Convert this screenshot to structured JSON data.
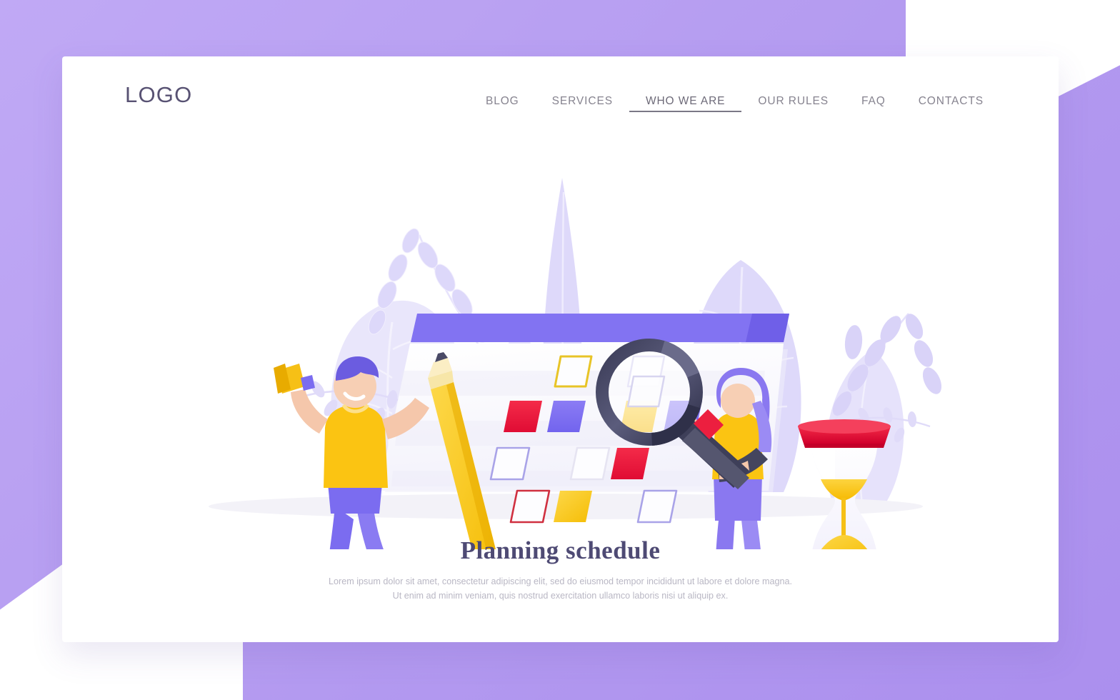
{
  "brand": {
    "logo_text": "LOGO",
    "logo_color": "#585273"
  },
  "nav": {
    "items": [
      {
        "label": "BLOG",
        "active": false
      },
      {
        "label": "SERVICES",
        "active": false
      },
      {
        "label": "WHO WE ARE",
        "active": true
      },
      {
        "label": "OUR RULES",
        "active": false
      },
      {
        "label": "FAQ",
        "active": false
      },
      {
        "label": "CONTACTS",
        "active": false
      }
    ]
  },
  "hero": {
    "title": "Planning schedule",
    "subtitle_line1": "Lorem ipsum dolor sit amet, consectetur adipiscing elit, sed do eiusmod tempor incididunt ut labore et dolore magna.",
    "subtitle_line2": "Ut enim ad minim veniam, quis nostrud exercitation ullamco laboris nisi ut aliquip ex.",
    "title_color": "#4e4a74",
    "subtitle_color": "#b9b7c4"
  },
  "theme": {
    "page_background": "#b9a1f2",
    "card_background": "#ffffff",
    "accent_purple": "#7c6cf0",
    "accent_yellow": "#fbc412",
    "accent_red": "#ec1f3f",
    "leaf_fill": "#e4e0fb",
    "calendar_header": "#8273f2",
    "magnifier_dark": "#4a4a66"
  },
  "illustration": {
    "name": "planning-schedule-illustration",
    "calendar": {
      "header_color": "#8273f2",
      "body_color": "#fbfbfe",
      "cells": [
        {
          "row": 1,
          "col": 1,
          "style": "empty"
        },
        {
          "row": 1,
          "col": 2,
          "style": "empty"
        },
        {
          "row": 1,
          "col": 3,
          "style": "outline-yellow"
        },
        {
          "row": 1,
          "col": 4,
          "style": "outline-lilac"
        },
        {
          "row": 1,
          "col": 5,
          "style": "empty"
        },
        {
          "row": 2,
          "col": 1,
          "style": "fill-red"
        },
        {
          "row": 2,
          "col": 2,
          "style": "fill-purple"
        },
        {
          "row": 2,
          "col": 3,
          "style": "empty"
        },
        {
          "row": 2,
          "col": 4,
          "style": "fill-yellow"
        },
        {
          "row": 2,
          "col": 5,
          "style": "fill-purple"
        },
        {
          "row": 3,
          "col": 1,
          "style": "outline-lilac"
        },
        {
          "row": 3,
          "col": 2,
          "style": "empty"
        },
        {
          "row": 3,
          "col": 3,
          "style": "outline-grey"
        },
        {
          "row": 3,
          "col": 4,
          "style": "fill-red"
        },
        {
          "row": 3,
          "col": 5,
          "style": "empty"
        },
        {
          "row": 4,
          "col": 1,
          "style": "empty"
        },
        {
          "row": 4,
          "col": 2,
          "style": "outline-red"
        },
        {
          "row": 4,
          "col": 3,
          "style": "fill-yellow"
        },
        {
          "row": 4,
          "col": 4,
          "style": "empty"
        },
        {
          "row": 4,
          "col": 5,
          "style": "outline-lilac"
        }
      ]
    },
    "characters": [
      {
        "name": "man-with-pencil-and-megaphone",
        "shirt": "#fbc412",
        "pants": "#7c6cf0",
        "hair": "#6b5ce0"
      },
      {
        "name": "woman-with-magnifier",
        "shirt": "#fbc412",
        "pants": "#8a78f0",
        "hair": "#8a78f0"
      }
    ],
    "objects": [
      {
        "name": "hourglass",
        "cap_color": "#e8183c",
        "sand_color": "#fbc412"
      },
      {
        "name": "magnifying-glass",
        "ring_color": "#414260",
        "handle_band": "#ec1f3f"
      },
      {
        "name": "giant-pencil",
        "body_color": "#f6c016",
        "eraser_color": "#e8183c"
      },
      {
        "name": "megaphone",
        "color": "#f6c016"
      }
    ]
  }
}
